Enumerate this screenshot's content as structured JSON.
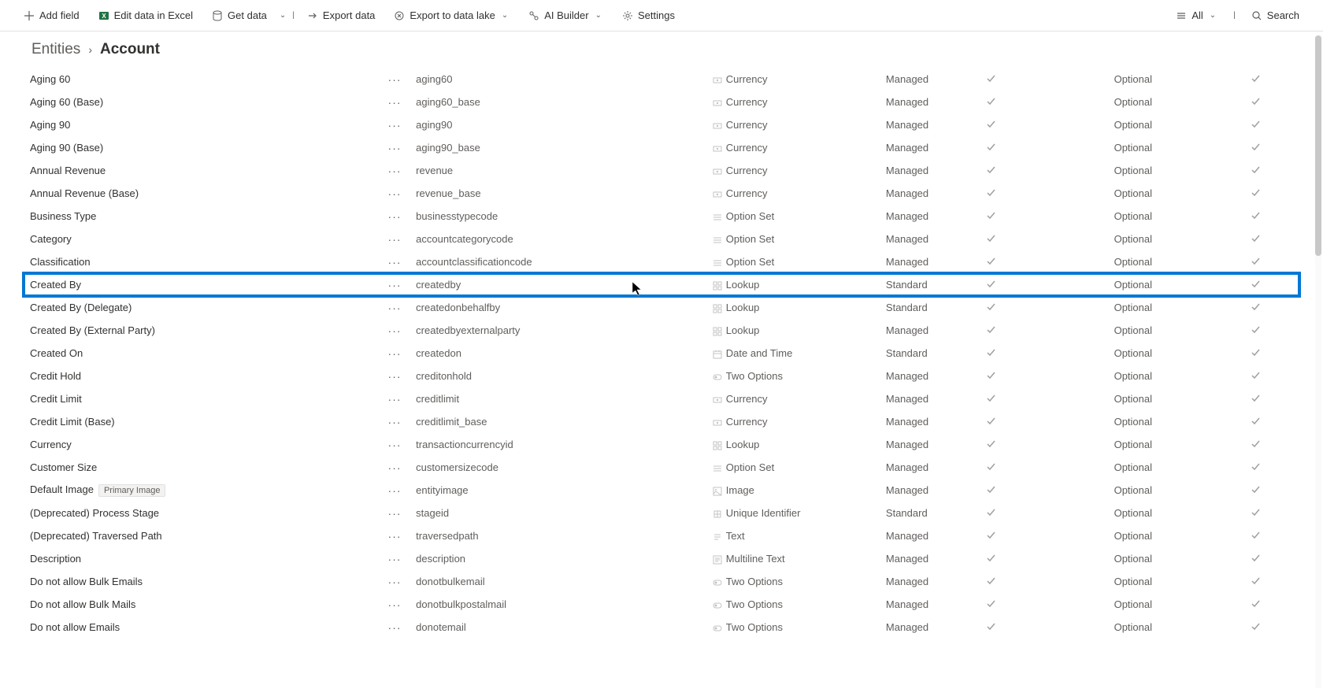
{
  "toolbar": {
    "addField": "Add field",
    "editExcel": "Edit data in Excel",
    "getData": "Get data",
    "exportData": "Export data",
    "exportLake": "Export to data lake",
    "aiBuilder": "AI Builder",
    "settings": "Settings",
    "allFilter": "All",
    "searchPlaceholder": "Search"
  },
  "breadcrumb": {
    "root": "Entities",
    "current": "Account"
  },
  "badges": {
    "primaryImage": "Primary Image"
  },
  "rows": [
    {
      "display": "Aging 60",
      "name": "aging60",
      "type": "Currency",
      "typeIcon": "currency",
      "managed": "Managed",
      "requirement": "Optional",
      "highlighted": false,
      "badge": null
    },
    {
      "display": "Aging 60 (Base)",
      "name": "aging60_base",
      "type": "Currency",
      "typeIcon": "currency",
      "managed": "Managed",
      "requirement": "Optional",
      "highlighted": false,
      "badge": null
    },
    {
      "display": "Aging 90",
      "name": "aging90",
      "type": "Currency",
      "typeIcon": "currency",
      "managed": "Managed",
      "requirement": "Optional",
      "highlighted": false,
      "badge": null
    },
    {
      "display": "Aging 90 (Base)",
      "name": "aging90_base",
      "type": "Currency",
      "typeIcon": "currency",
      "managed": "Managed",
      "requirement": "Optional",
      "highlighted": false,
      "badge": null
    },
    {
      "display": "Annual Revenue",
      "name": "revenue",
      "type": "Currency",
      "typeIcon": "currency",
      "managed": "Managed",
      "requirement": "Optional",
      "highlighted": false,
      "badge": null
    },
    {
      "display": "Annual Revenue (Base)",
      "name": "revenue_base",
      "type": "Currency",
      "typeIcon": "currency",
      "managed": "Managed",
      "requirement": "Optional",
      "highlighted": false,
      "badge": null
    },
    {
      "display": "Business Type",
      "name": "businesstypecode",
      "type": "Option Set",
      "typeIcon": "optionset",
      "managed": "Managed",
      "requirement": "Optional",
      "highlighted": false,
      "badge": null
    },
    {
      "display": "Category",
      "name": "accountcategorycode",
      "type": "Option Set",
      "typeIcon": "optionset",
      "managed": "Managed",
      "requirement": "Optional",
      "highlighted": false,
      "badge": null
    },
    {
      "display": "Classification",
      "name": "accountclassificationcode",
      "type": "Option Set",
      "typeIcon": "optionset",
      "managed": "Managed",
      "requirement": "Optional",
      "highlighted": false,
      "badge": null
    },
    {
      "display": "Created By",
      "name": "createdby",
      "type": "Lookup",
      "typeIcon": "lookup",
      "managed": "Standard",
      "requirement": "Optional",
      "highlighted": true,
      "badge": null
    },
    {
      "display": "Created By (Delegate)",
      "name": "createdonbehalfby",
      "type": "Lookup",
      "typeIcon": "lookup",
      "managed": "Standard",
      "requirement": "Optional",
      "highlighted": false,
      "badge": null
    },
    {
      "display": "Created By (External Party)",
      "name": "createdbyexternalparty",
      "type": "Lookup",
      "typeIcon": "lookup",
      "managed": "Managed",
      "requirement": "Optional",
      "highlighted": false,
      "badge": null
    },
    {
      "display": "Created On",
      "name": "createdon",
      "type": "Date and Time",
      "typeIcon": "datetime",
      "managed": "Standard",
      "requirement": "Optional",
      "highlighted": false,
      "badge": null
    },
    {
      "display": "Credit Hold",
      "name": "creditonhold",
      "type": "Two Options",
      "typeIcon": "twooptions",
      "managed": "Managed",
      "requirement": "Optional",
      "highlighted": false,
      "badge": null
    },
    {
      "display": "Credit Limit",
      "name": "creditlimit",
      "type": "Currency",
      "typeIcon": "currency",
      "managed": "Managed",
      "requirement": "Optional",
      "highlighted": false,
      "badge": null
    },
    {
      "display": "Credit Limit (Base)",
      "name": "creditlimit_base",
      "type": "Currency",
      "typeIcon": "currency",
      "managed": "Managed",
      "requirement": "Optional",
      "highlighted": false,
      "badge": null
    },
    {
      "display": "Currency",
      "name": "transactioncurrencyid",
      "type": "Lookup",
      "typeIcon": "lookup",
      "managed": "Managed",
      "requirement": "Optional",
      "highlighted": false,
      "badge": null
    },
    {
      "display": "Customer Size",
      "name": "customersizecode",
      "type": "Option Set",
      "typeIcon": "optionset",
      "managed": "Managed",
      "requirement": "Optional",
      "highlighted": false,
      "badge": null
    },
    {
      "display": "Default Image",
      "name": "entityimage",
      "type": "Image",
      "typeIcon": "image",
      "managed": "Managed",
      "requirement": "Optional",
      "highlighted": false,
      "badge": "primaryImage"
    },
    {
      "display": "(Deprecated) Process Stage",
      "name": "stageid",
      "type": "Unique Identifier",
      "typeIcon": "unique",
      "managed": "Standard",
      "requirement": "Optional",
      "highlighted": false,
      "badge": null
    },
    {
      "display": "(Deprecated) Traversed Path",
      "name": "traversedpath",
      "type": "Text",
      "typeIcon": "text",
      "managed": "Managed",
      "requirement": "Optional",
      "highlighted": false,
      "badge": null
    },
    {
      "display": "Description",
      "name": "description",
      "type": "Multiline Text",
      "typeIcon": "multitext",
      "managed": "Managed",
      "requirement": "Optional",
      "highlighted": false,
      "badge": null
    },
    {
      "display": "Do not allow Bulk Emails",
      "name": "donotbulkemail",
      "type": "Two Options",
      "typeIcon": "twooptions",
      "managed": "Managed",
      "requirement": "Optional",
      "highlighted": false,
      "badge": null
    },
    {
      "display": "Do not allow Bulk Mails",
      "name": "donotbulkpostalmail",
      "type": "Two Options",
      "typeIcon": "twooptions",
      "managed": "Managed",
      "requirement": "Optional",
      "highlighted": false,
      "badge": null
    },
    {
      "display": "Do not allow Emails",
      "name": "donotemail",
      "type": "Two Options",
      "typeIcon": "twooptions",
      "managed": "Managed",
      "requirement": "Optional",
      "highlighted": false,
      "badge": null
    }
  ]
}
